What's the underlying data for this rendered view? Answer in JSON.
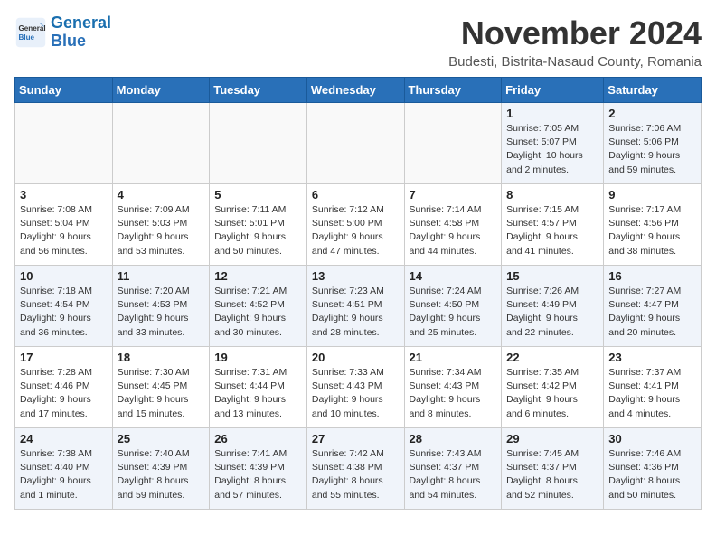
{
  "logo": {
    "line1": "General",
    "line2": "Blue"
  },
  "header": {
    "month": "November 2024",
    "location": "Budesti, Bistrita-Nasaud County, Romania"
  },
  "weekdays": [
    "Sunday",
    "Monday",
    "Tuesday",
    "Wednesday",
    "Thursday",
    "Friday",
    "Saturday"
  ],
  "weeks": [
    [
      {
        "day": "",
        "info": ""
      },
      {
        "day": "",
        "info": ""
      },
      {
        "day": "",
        "info": ""
      },
      {
        "day": "",
        "info": ""
      },
      {
        "day": "",
        "info": ""
      },
      {
        "day": "1",
        "info": "Sunrise: 7:05 AM\nSunset: 5:07 PM\nDaylight: 10 hours\nand 2 minutes."
      },
      {
        "day": "2",
        "info": "Sunrise: 7:06 AM\nSunset: 5:06 PM\nDaylight: 9 hours\nand 59 minutes."
      }
    ],
    [
      {
        "day": "3",
        "info": "Sunrise: 7:08 AM\nSunset: 5:04 PM\nDaylight: 9 hours\nand 56 minutes."
      },
      {
        "day": "4",
        "info": "Sunrise: 7:09 AM\nSunset: 5:03 PM\nDaylight: 9 hours\nand 53 minutes."
      },
      {
        "day": "5",
        "info": "Sunrise: 7:11 AM\nSunset: 5:01 PM\nDaylight: 9 hours\nand 50 minutes."
      },
      {
        "day": "6",
        "info": "Sunrise: 7:12 AM\nSunset: 5:00 PM\nDaylight: 9 hours\nand 47 minutes."
      },
      {
        "day": "7",
        "info": "Sunrise: 7:14 AM\nSunset: 4:58 PM\nDaylight: 9 hours\nand 44 minutes."
      },
      {
        "day": "8",
        "info": "Sunrise: 7:15 AM\nSunset: 4:57 PM\nDaylight: 9 hours\nand 41 minutes."
      },
      {
        "day": "9",
        "info": "Sunrise: 7:17 AM\nSunset: 4:56 PM\nDaylight: 9 hours\nand 38 minutes."
      }
    ],
    [
      {
        "day": "10",
        "info": "Sunrise: 7:18 AM\nSunset: 4:54 PM\nDaylight: 9 hours\nand 36 minutes."
      },
      {
        "day": "11",
        "info": "Sunrise: 7:20 AM\nSunset: 4:53 PM\nDaylight: 9 hours\nand 33 minutes."
      },
      {
        "day": "12",
        "info": "Sunrise: 7:21 AM\nSunset: 4:52 PM\nDaylight: 9 hours\nand 30 minutes."
      },
      {
        "day": "13",
        "info": "Sunrise: 7:23 AM\nSunset: 4:51 PM\nDaylight: 9 hours\nand 28 minutes."
      },
      {
        "day": "14",
        "info": "Sunrise: 7:24 AM\nSunset: 4:50 PM\nDaylight: 9 hours\nand 25 minutes."
      },
      {
        "day": "15",
        "info": "Sunrise: 7:26 AM\nSunset: 4:49 PM\nDaylight: 9 hours\nand 22 minutes."
      },
      {
        "day": "16",
        "info": "Sunrise: 7:27 AM\nSunset: 4:47 PM\nDaylight: 9 hours\nand 20 minutes."
      }
    ],
    [
      {
        "day": "17",
        "info": "Sunrise: 7:28 AM\nSunset: 4:46 PM\nDaylight: 9 hours\nand 17 minutes."
      },
      {
        "day": "18",
        "info": "Sunrise: 7:30 AM\nSunset: 4:45 PM\nDaylight: 9 hours\nand 15 minutes."
      },
      {
        "day": "19",
        "info": "Sunrise: 7:31 AM\nSunset: 4:44 PM\nDaylight: 9 hours\nand 13 minutes."
      },
      {
        "day": "20",
        "info": "Sunrise: 7:33 AM\nSunset: 4:43 PM\nDaylight: 9 hours\nand 10 minutes."
      },
      {
        "day": "21",
        "info": "Sunrise: 7:34 AM\nSunset: 4:43 PM\nDaylight: 9 hours\nand 8 minutes."
      },
      {
        "day": "22",
        "info": "Sunrise: 7:35 AM\nSunset: 4:42 PM\nDaylight: 9 hours\nand 6 minutes."
      },
      {
        "day": "23",
        "info": "Sunrise: 7:37 AM\nSunset: 4:41 PM\nDaylight: 9 hours\nand 4 minutes."
      }
    ],
    [
      {
        "day": "24",
        "info": "Sunrise: 7:38 AM\nSunset: 4:40 PM\nDaylight: 9 hours\nand 1 minute."
      },
      {
        "day": "25",
        "info": "Sunrise: 7:40 AM\nSunset: 4:39 PM\nDaylight: 8 hours\nand 59 minutes."
      },
      {
        "day": "26",
        "info": "Sunrise: 7:41 AM\nSunset: 4:39 PM\nDaylight: 8 hours\nand 57 minutes."
      },
      {
        "day": "27",
        "info": "Sunrise: 7:42 AM\nSunset: 4:38 PM\nDaylight: 8 hours\nand 55 minutes."
      },
      {
        "day": "28",
        "info": "Sunrise: 7:43 AM\nSunset: 4:37 PM\nDaylight: 8 hours\nand 54 minutes."
      },
      {
        "day": "29",
        "info": "Sunrise: 7:45 AM\nSunset: 4:37 PM\nDaylight: 8 hours\nand 52 minutes."
      },
      {
        "day": "30",
        "info": "Sunrise: 7:46 AM\nSunset: 4:36 PM\nDaylight: 8 hours\nand 50 minutes."
      }
    ]
  ]
}
